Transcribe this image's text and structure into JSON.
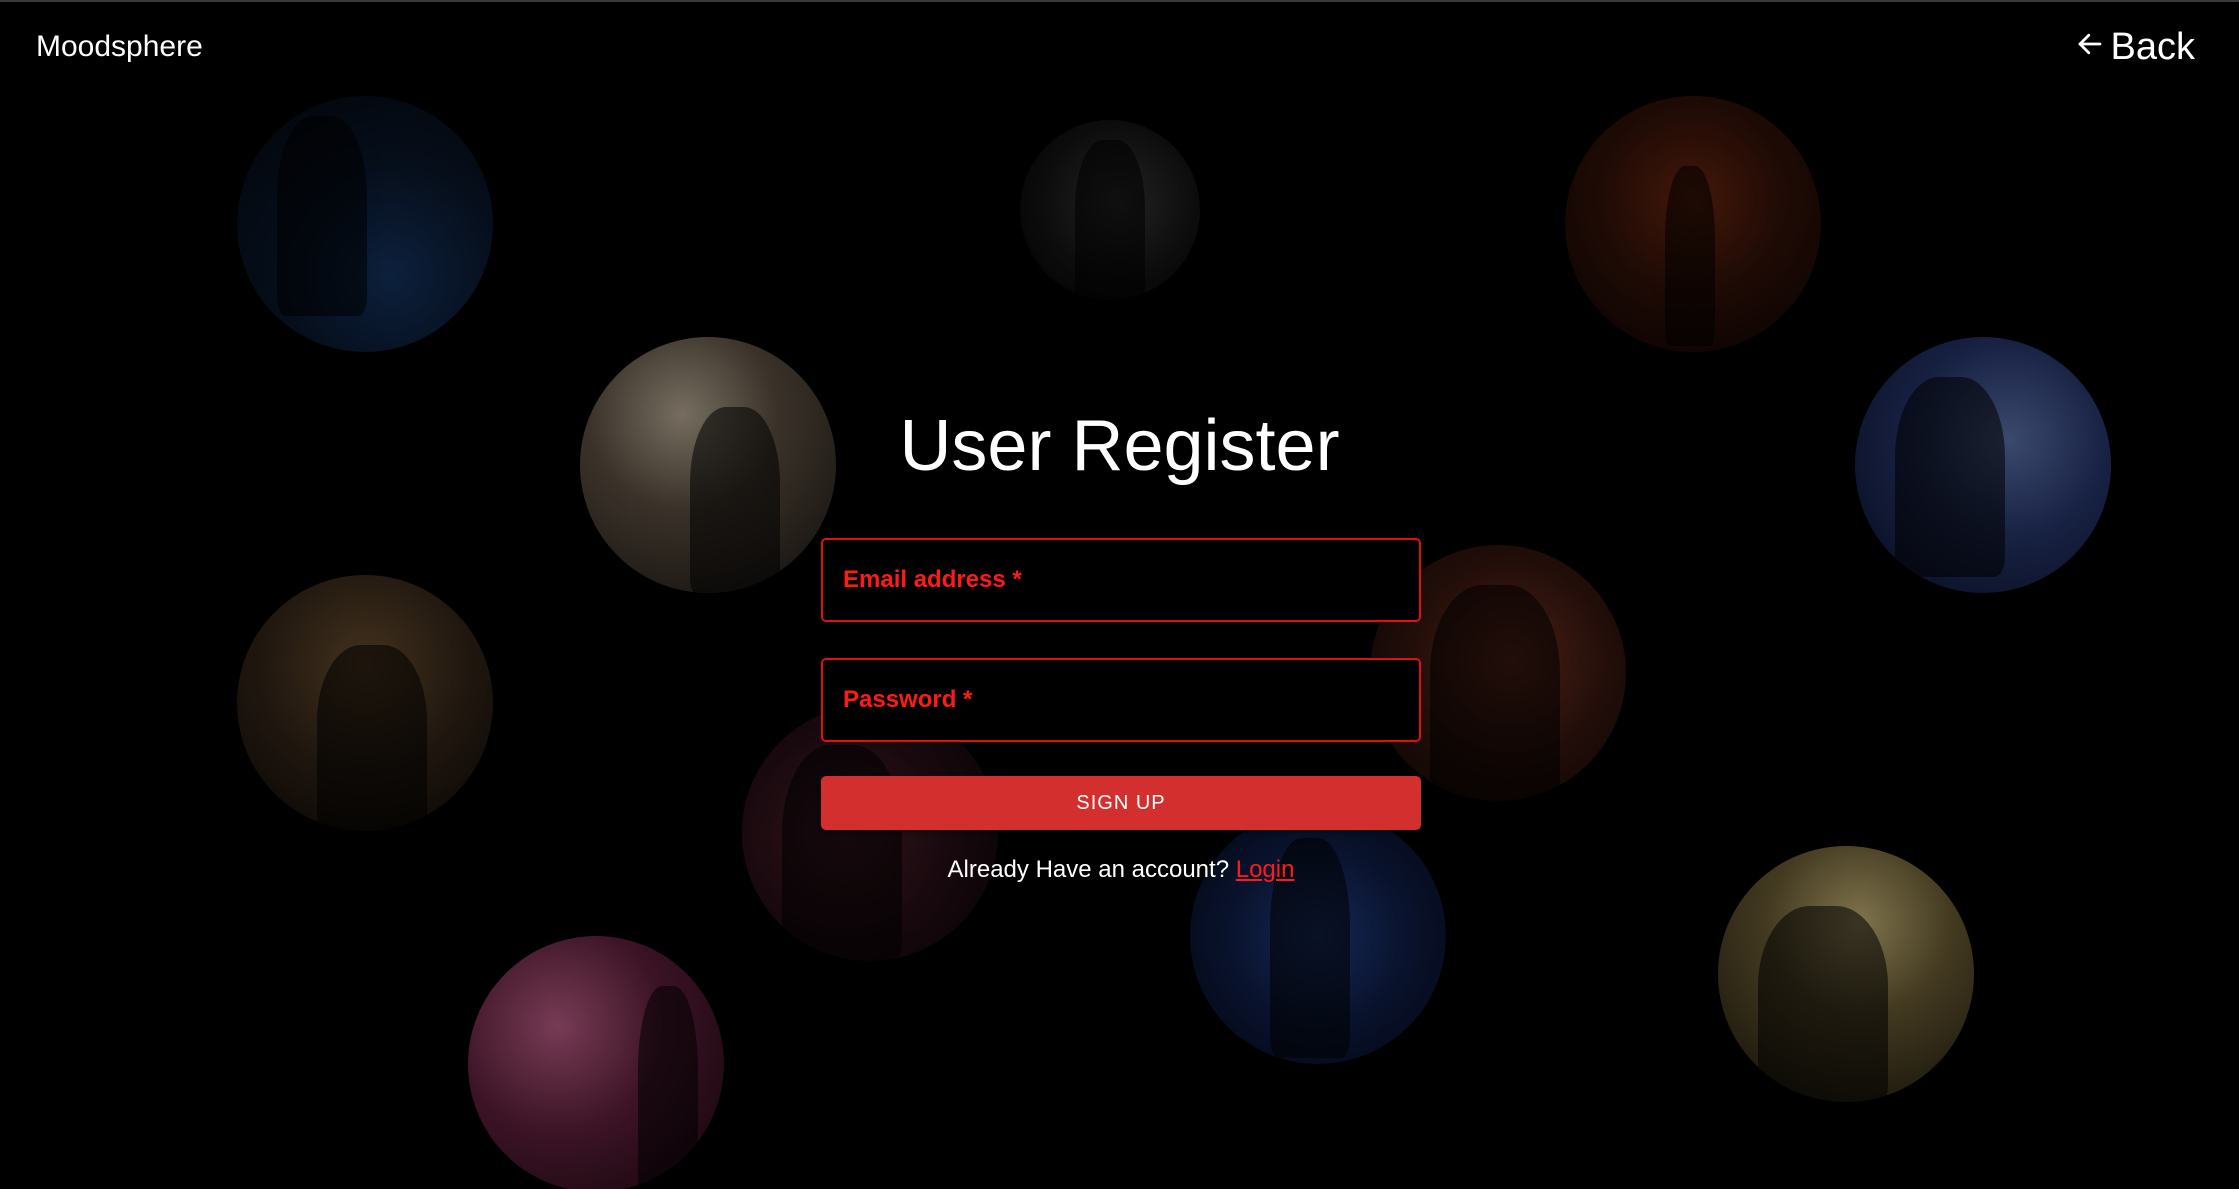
{
  "header": {
    "brand": "Moodsphere",
    "back_label": "Back"
  },
  "form": {
    "title": "User Register",
    "email_label": "Email address *",
    "password_label": "Password *",
    "submit_label": "SIGN UP",
    "footer_text": "Already Have an account?",
    "login_link": "Login"
  },
  "colors": {
    "background": "#000000",
    "accent": "#d32f2f",
    "field_border": "#e01010",
    "label_red": "#ff1a1a"
  },
  "icons": {
    "back": "arrow-left-icon"
  }
}
